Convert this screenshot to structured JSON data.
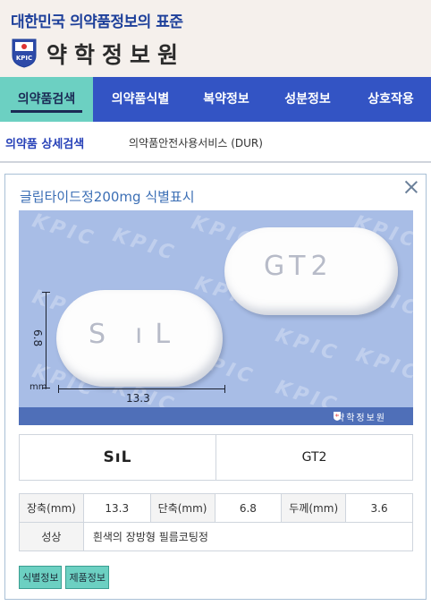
{
  "header": {
    "slogan": "대한민국 의약품정보의 표준",
    "logo_text": "KPIC",
    "org_name": "약학정보원"
  },
  "main_nav": [
    {
      "label": "의약품검색",
      "active": true
    },
    {
      "label": "의약품식별",
      "active": false
    },
    {
      "label": "복약정보",
      "active": false
    },
    {
      "label": "성분정보",
      "active": false
    },
    {
      "label": "상호작용",
      "active": false
    }
  ],
  "sub_nav": {
    "active": "의약품 상세검색",
    "other": "의약품안전사용서비스 (DUR)"
  },
  "detail": {
    "title": "글립타이드정200mg 식별표시",
    "image": {
      "watermark": "KPIC",
      "footer_text": "약학정보원",
      "pill_front_imprint": "S ıL",
      "pill_back_imprint": "GT2",
      "dim_height": "6.8",
      "dim_width": "13.3",
      "dim_unit": "mm"
    },
    "marks": {
      "front": "SıL",
      "back": "GT2"
    },
    "spec": {
      "long_axis_label": "장축(mm)",
      "long_axis_value": "13.3",
      "short_axis_label": "단축(mm)",
      "short_axis_value": "6.8",
      "thickness_label": "두께(mm)",
      "thickness_value": "3.6",
      "property_label": "성상",
      "property_value": "흰색의 장방형 필름코팅정"
    },
    "buttons": {
      "identify": "식별정보",
      "product": "제품정보"
    }
  },
  "colors": {
    "nav_bg": "#3354c4",
    "nav_active": "#6cd0c2",
    "image_bg": "#a8bde6",
    "title": "#3c6fb5"
  }
}
